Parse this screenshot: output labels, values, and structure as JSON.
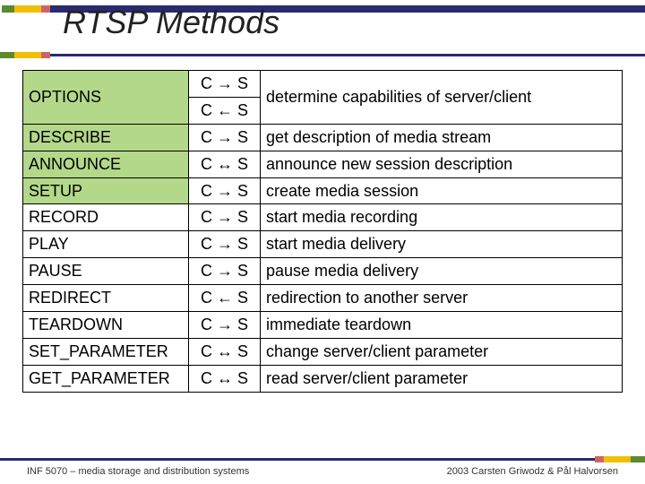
{
  "title": "RTSP Methods",
  "arrows": {
    "right": "→",
    "left": "←",
    "both": "↔"
  },
  "rows": [
    {
      "name": "OPTIONS",
      "dir": [
        "C → S",
        "C ← S"
      ],
      "desc": "determine capabilities of server/client",
      "green": true,
      "rowspan": 1
    },
    {
      "name": "DESCRIBE",
      "dir": [
        "C → S"
      ],
      "desc": "get description of media stream",
      "green": true
    },
    {
      "name": "ANNOUNCE",
      "dir": [
        "C ↔ S"
      ],
      "desc": "announce new session description",
      "green": true
    },
    {
      "name": "SETUP",
      "dir": [
        "C → S"
      ],
      "desc": "create media session",
      "green": true
    },
    {
      "name": "RECORD",
      "dir": [
        "C → S"
      ],
      "desc": "start media recording",
      "green": false
    },
    {
      "name": "PLAY",
      "dir": [
        "C → S"
      ],
      "desc": "start media delivery",
      "green": false
    },
    {
      "name": "PAUSE",
      "dir": [
        "C → S"
      ],
      "desc": "pause media delivery",
      "green": false
    },
    {
      "name": "REDIRECT",
      "dir": [
        "C ← S"
      ],
      "desc": "redirection to another server",
      "green": false
    },
    {
      "name": "TEARDOWN",
      "dir": [
        "C → S"
      ],
      "desc": "immediate teardown",
      "green": false
    },
    {
      "name": "SET_PARAMETER",
      "dir": [
        "C ↔ S"
      ],
      "desc": "change server/client parameter",
      "green": false
    },
    {
      "name": "GET_PARAMETER",
      "dir": [
        "C ↔ S"
      ],
      "desc": "read server/client parameter",
      "green": false
    }
  ],
  "footer": {
    "left": "INF 5070 – media storage and distribution systems",
    "right": "2003  Carsten Griwodz & Pål Halvorsen"
  }
}
